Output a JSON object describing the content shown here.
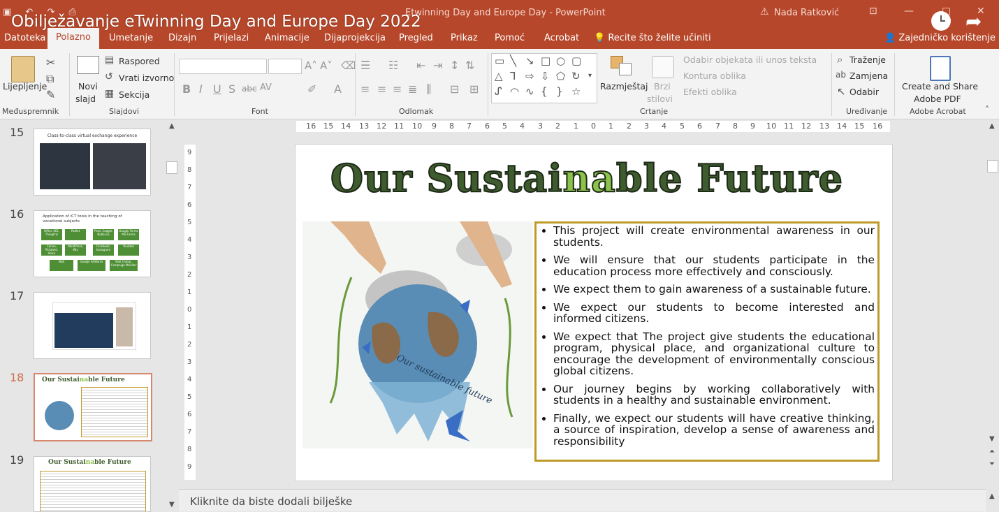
{
  "video_title": "Obilježavanje eTwinning Day and Europe Day 2022",
  "window": {
    "document_title": "Etwinning Day and Europe Day  -  PowerPoint",
    "user": "Nada Ratković"
  },
  "tabs": [
    "Datoteka",
    "Polazno",
    "Umetanje",
    "Dizajn",
    "Prijelazi",
    "Animacije",
    "Dijaprojekcija",
    "Pregled",
    "Prikaz",
    "Pomoć",
    "Acrobat"
  ],
  "active_tab": "Polazno",
  "tell_me": "Recite što želite učiniti",
  "collaborate": "Zajedničko korištenje",
  "ribbon": {
    "clipboard": {
      "paste": "Lijepljenje",
      "group": "Međuspremnik"
    },
    "slides": {
      "new_slide_1": "Novi",
      "new_slide_2": "slajd",
      "layout": "Raspored",
      "reset": "Vrati izvorno",
      "section": "Sekcija",
      "group": "Slajdovi"
    },
    "font": {
      "group": "Font"
    },
    "paragraph": {
      "group": "Odlomak"
    },
    "drawing": {
      "arrange": "Razmještaj",
      "quick_styles_1": "Brzi",
      "quick_styles_2": "stilovi",
      "shape_fill": "Odabir objekata ili unos teksta",
      "shape_outline": "Kontura oblika",
      "shape_effects": "Efekti oblika",
      "group": "Crtanje"
    },
    "editing": {
      "find": "Traženje",
      "replace": "Zamjena",
      "select": "Odabir",
      "group": "Uređivanje"
    },
    "acrobat": {
      "line1": "Create and Share",
      "line2": "Adobe PDF",
      "group": "Adobe Acrobat"
    }
  },
  "thumbnails": [
    {
      "num": "15",
      "title": "Class-to-class virtual exchange experience"
    },
    {
      "num": "16",
      "title": "Application of ICT tools in the teaching of vocational subjects",
      "tiles": [
        "Office 365, Thinglink",
        "Padlet",
        "Prezi, Coggle, Bubbl.us",
        "Google Forms MS Forms",
        "Canva, Pictalent, Voice",
        "WordPress, Wix",
        "Facebook, Instagram",
        "Youtube",
        "Wall",
        "Google AdWords",
        "Mail Chimp, Campaign Monitor"
      ]
    },
    {
      "num": "17"
    },
    {
      "num": "18",
      "title_a": "Our Sustai",
      "title_hl": "na",
      "title_b": "ble Future"
    },
    {
      "num": "19",
      "title_a": "Our Sustai",
      "title_hl": "na",
      "title_b": "ble Future"
    }
  ],
  "ruler_labels": [
    "16",
    "15",
    "14",
    "13",
    "12",
    "11",
    "10",
    "9",
    "8",
    "7",
    "6",
    "5",
    "4",
    "3",
    "2",
    "1",
    "0",
    "1",
    "2",
    "3",
    "4",
    "5",
    "6",
    "7",
    "8",
    "9",
    "10",
    "11",
    "12",
    "13",
    "14",
    "15",
    "16"
  ],
  "vruler_labels": [
    "9",
    "8",
    "7",
    "6",
    "5",
    "4",
    "3",
    "2",
    "1",
    "0",
    "1",
    "2",
    "3",
    "4",
    "5",
    "6",
    "7",
    "8",
    "9"
  ],
  "slide": {
    "title_a": "Our Sustai",
    "title_hl": "na",
    "title_b": "ble Future",
    "globe_text": "Our sustainable future",
    "bullets": [
      "This project will create environmental awareness in our students.",
      "We will ensure that our students participate in the education process more effectively and consciously.",
      "We expect them to gain awareness of a sustainable future.",
      "We expect our students to become interested and informed citizens.",
      "We expect that The project give students the educational program, physical place, and organizational culture to encourage the development of environmentally conscious global citizens.",
      "Our journey begins by working collaboratively with students in a healthy and sustainable environment.",
      " Finally, we expect our students will have creative thinking, a source of inspiration, develop a sense of awareness and responsibility"
    ]
  },
  "notes_placeholder": "Kliknite da biste dodali bilješke",
  "colors": {
    "accent": "#b7472a",
    "border_gold": "#bf9a2b",
    "title_green": "#3f5c2f",
    "highlight_green": "#8bc34a"
  }
}
